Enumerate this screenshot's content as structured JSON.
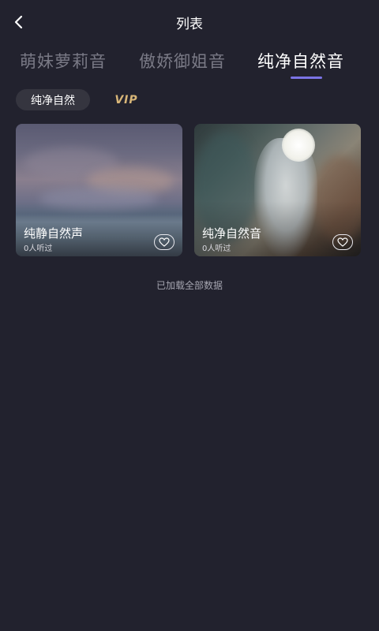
{
  "header": {
    "title": "列表",
    "back_icon": "chevron-left-icon"
  },
  "tabs": [
    {
      "label": "萌妹萝莉音",
      "active": false
    },
    {
      "label": "傲娇御姐音",
      "active": false
    },
    {
      "label": "纯净自然音",
      "active": true
    }
  ],
  "chips": {
    "active_label": "纯净自然",
    "vip_label": "VIP"
  },
  "cards": [
    {
      "title": "纯静自然声",
      "listeners": "0人听过",
      "fav_icon": "heart-icon"
    },
    {
      "title": "纯净自然音",
      "listeners": "0人听过",
      "fav_icon": "heart-icon"
    }
  ],
  "footer": {
    "note": "已加载全部数据"
  },
  "colors": {
    "background": "#22222e",
    "tab_indicator": "#7b74e6",
    "vip": "#d8b678"
  }
}
